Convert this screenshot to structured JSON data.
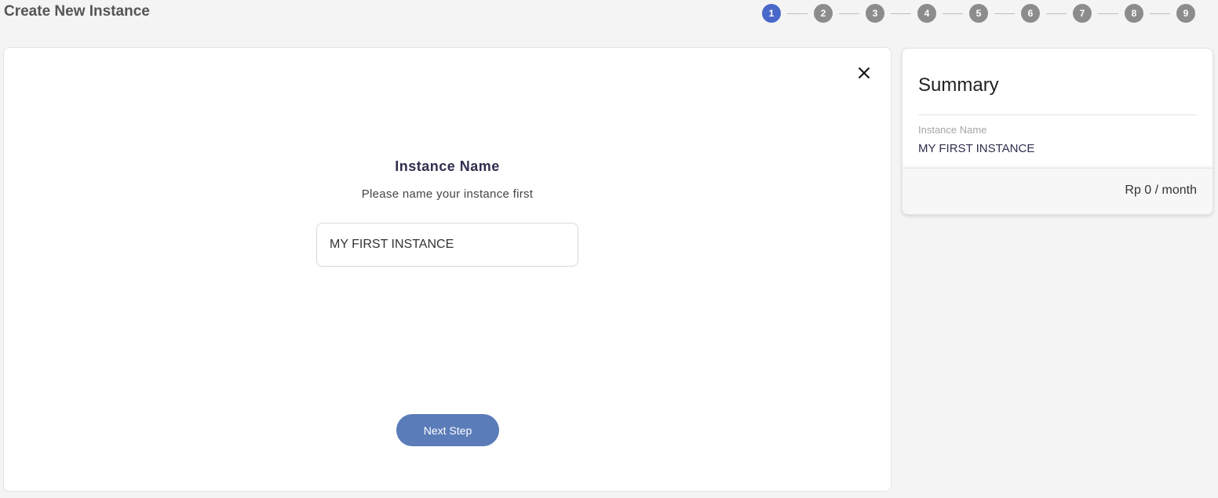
{
  "header": {
    "title": "Create New Instance"
  },
  "stepper": {
    "steps": [
      "1",
      "2",
      "3",
      "4",
      "5",
      "6",
      "7",
      "8",
      "9"
    ],
    "active_step": 1,
    "active_color": "#4a68c9",
    "inactive_color": "#8c8c8c"
  },
  "form": {
    "title": "Instance Name",
    "subtitle": "Please name your instance first",
    "input_value": "MY FIRST INSTANCE",
    "next_button_label": "Next Step",
    "close_icon": "close-icon"
  },
  "summary": {
    "title": "Summary",
    "field_label": "Instance Name",
    "field_value": "MY FIRST INSTANCE",
    "price": "Rp 0 / month"
  },
  "colors": {
    "accent": "#5a7cb9",
    "background": "#f4f4f4"
  }
}
